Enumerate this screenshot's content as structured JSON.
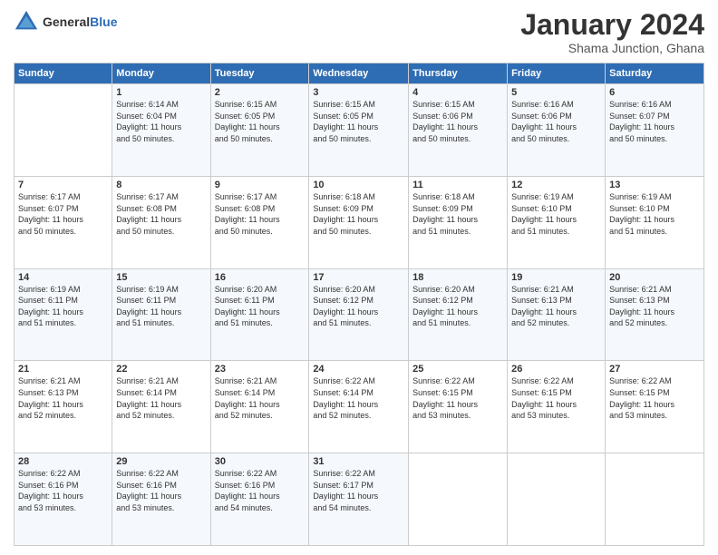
{
  "header": {
    "logo_line1": "General",
    "logo_line2": "Blue",
    "title": "January 2024",
    "subtitle": "Shama Junction, Ghana"
  },
  "columns": [
    "Sunday",
    "Monday",
    "Tuesday",
    "Wednesday",
    "Thursday",
    "Friday",
    "Saturday"
  ],
  "weeks": [
    [
      {
        "day": "",
        "info": ""
      },
      {
        "day": "1",
        "info": "Sunrise: 6:14 AM\nSunset: 6:04 PM\nDaylight: 11 hours\nand 50 minutes."
      },
      {
        "day": "2",
        "info": "Sunrise: 6:15 AM\nSunset: 6:05 PM\nDaylight: 11 hours\nand 50 minutes."
      },
      {
        "day": "3",
        "info": "Sunrise: 6:15 AM\nSunset: 6:05 PM\nDaylight: 11 hours\nand 50 minutes."
      },
      {
        "day": "4",
        "info": "Sunrise: 6:15 AM\nSunset: 6:06 PM\nDaylight: 11 hours\nand 50 minutes."
      },
      {
        "day": "5",
        "info": "Sunrise: 6:16 AM\nSunset: 6:06 PM\nDaylight: 11 hours\nand 50 minutes."
      },
      {
        "day": "6",
        "info": "Sunrise: 6:16 AM\nSunset: 6:07 PM\nDaylight: 11 hours\nand 50 minutes."
      }
    ],
    [
      {
        "day": "7",
        "info": "Sunrise: 6:17 AM\nSunset: 6:07 PM\nDaylight: 11 hours\nand 50 minutes."
      },
      {
        "day": "8",
        "info": "Sunrise: 6:17 AM\nSunset: 6:08 PM\nDaylight: 11 hours\nand 50 minutes."
      },
      {
        "day": "9",
        "info": "Sunrise: 6:17 AM\nSunset: 6:08 PM\nDaylight: 11 hours\nand 50 minutes."
      },
      {
        "day": "10",
        "info": "Sunrise: 6:18 AM\nSunset: 6:09 PM\nDaylight: 11 hours\nand 50 minutes."
      },
      {
        "day": "11",
        "info": "Sunrise: 6:18 AM\nSunset: 6:09 PM\nDaylight: 11 hours\nand 51 minutes."
      },
      {
        "day": "12",
        "info": "Sunrise: 6:19 AM\nSunset: 6:10 PM\nDaylight: 11 hours\nand 51 minutes."
      },
      {
        "day": "13",
        "info": "Sunrise: 6:19 AM\nSunset: 6:10 PM\nDaylight: 11 hours\nand 51 minutes."
      }
    ],
    [
      {
        "day": "14",
        "info": "Sunrise: 6:19 AM\nSunset: 6:11 PM\nDaylight: 11 hours\nand 51 minutes."
      },
      {
        "day": "15",
        "info": "Sunrise: 6:19 AM\nSunset: 6:11 PM\nDaylight: 11 hours\nand 51 minutes."
      },
      {
        "day": "16",
        "info": "Sunrise: 6:20 AM\nSunset: 6:11 PM\nDaylight: 11 hours\nand 51 minutes."
      },
      {
        "day": "17",
        "info": "Sunrise: 6:20 AM\nSunset: 6:12 PM\nDaylight: 11 hours\nand 51 minutes."
      },
      {
        "day": "18",
        "info": "Sunrise: 6:20 AM\nSunset: 6:12 PM\nDaylight: 11 hours\nand 51 minutes."
      },
      {
        "day": "19",
        "info": "Sunrise: 6:21 AM\nSunset: 6:13 PM\nDaylight: 11 hours\nand 52 minutes."
      },
      {
        "day": "20",
        "info": "Sunrise: 6:21 AM\nSunset: 6:13 PM\nDaylight: 11 hours\nand 52 minutes."
      }
    ],
    [
      {
        "day": "21",
        "info": "Sunrise: 6:21 AM\nSunset: 6:13 PM\nDaylight: 11 hours\nand 52 minutes."
      },
      {
        "day": "22",
        "info": "Sunrise: 6:21 AM\nSunset: 6:14 PM\nDaylight: 11 hours\nand 52 minutes."
      },
      {
        "day": "23",
        "info": "Sunrise: 6:21 AM\nSunset: 6:14 PM\nDaylight: 11 hours\nand 52 minutes."
      },
      {
        "day": "24",
        "info": "Sunrise: 6:22 AM\nSunset: 6:14 PM\nDaylight: 11 hours\nand 52 minutes."
      },
      {
        "day": "25",
        "info": "Sunrise: 6:22 AM\nSunset: 6:15 PM\nDaylight: 11 hours\nand 53 minutes."
      },
      {
        "day": "26",
        "info": "Sunrise: 6:22 AM\nSunset: 6:15 PM\nDaylight: 11 hours\nand 53 minutes."
      },
      {
        "day": "27",
        "info": "Sunrise: 6:22 AM\nSunset: 6:15 PM\nDaylight: 11 hours\nand 53 minutes."
      }
    ],
    [
      {
        "day": "28",
        "info": "Sunrise: 6:22 AM\nSunset: 6:16 PM\nDaylight: 11 hours\nand 53 minutes."
      },
      {
        "day": "29",
        "info": "Sunrise: 6:22 AM\nSunset: 6:16 PM\nDaylight: 11 hours\nand 53 minutes."
      },
      {
        "day": "30",
        "info": "Sunrise: 6:22 AM\nSunset: 6:16 PM\nDaylight: 11 hours\nand 54 minutes."
      },
      {
        "day": "31",
        "info": "Sunrise: 6:22 AM\nSunset: 6:17 PM\nDaylight: 11 hours\nand 54 minutes."
      },
      {
        "day": "",
        "info": ""
      },
      {
        "day": "",
        "info": ""
      },
      {
        "day": "",
        "info": ""
      }
    ]
  ]
}
